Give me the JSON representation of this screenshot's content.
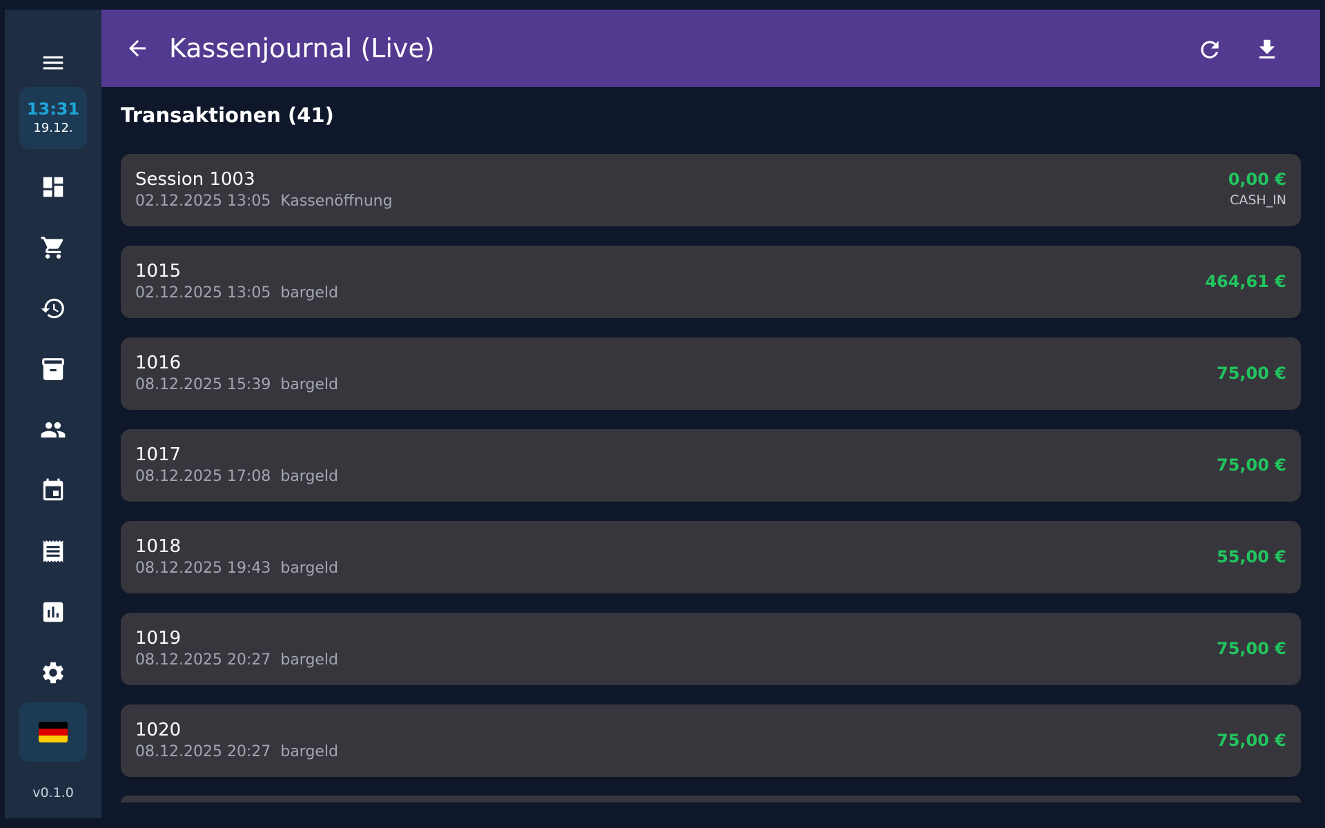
{
  "sidebar": {
    "clock_time": "13:31",
    "clock_date": "19.12.",
    "version": "v0.1.0",
    "flag_colors": [
      "#000000",
      "#dd0000",
      "#ffce00"
    ],
    "nav_icons": [
      "dashboard-icon",
      "cart-icon",
      "history-icon",
      "archive-icon",
      "people-icon",
      "calendar-icon",
      "receipt-icon",
      "report-icon",
      "settings-icon"
    ]
  },
  "appbar": {
    "title": "Kassenjournal (Live)",
    "color": "#523a90"
  },
  "section": {
    "title": "Transaktionen (41)"
  },
  "transactions": [
    {
      "name": "Session 1003",
      "datetime": "02.12.2025 13:05",
      "method": "Kassenöffnung",
      "amount": "0,00 €",
      "type": "CASH_IN"
    },
    {
      "name": "1015",
      "datetime": "02.12.2025 13:05",
      "method": "bargeld",
      "amount": "464,61 €"
    },
    {
      "name": "1016",
      "datetime": "08.12.2025 15:39",
      "method": "bargeld",
      "amount": "75,00 €"
    },
    {
      "name": "1017",
      "datetime": "08.12.2025 17:08",
      "method": "bargeld",
      "amount": "75,00 €"
    },
    {
      "name": "1018",
      "datetime": "08.12.2025 19:43",
      "method": "bargeld",
      "amount": "55,00 €"
    },
    {
      "name": "1019",
      "datetime": "08.12.2025 20:27",
      "method": "bargeld",
      "amount": "75,00 €"
    },
    {
      "name": "1020",
      "datetime": "08.12.2025 20:27",
      "method": "bargeld",
      "amount": "75,00 €"
    }
  ],
  "colors": {
    "amount_positive": "#21c45d",
    "background": "#0f172a",
    "card": "#37363c",
    "sidebar": "#1e2d42"
  }
}
